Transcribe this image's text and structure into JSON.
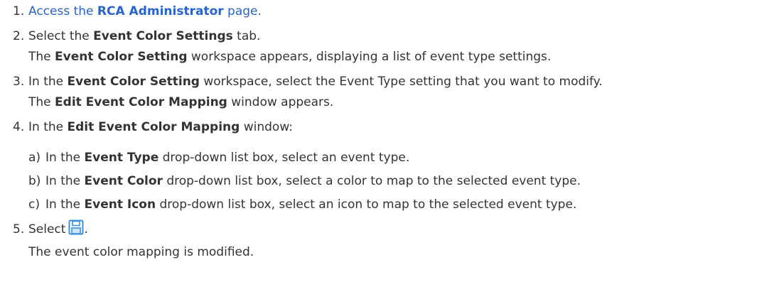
{
  "steps": [
    {
      "num": "1.",
      "pre": "Access the ",
      "bold": "RCA Administrator",
      "post": " page."
    },
    {
      "num": "2.",
      "pre": "Select the ",
      "bold": "Event Color Settings",
      "post": " tab.",
      "result_pre": "The ",
      "result_bold": "Event Color Setting",
      "result_post": " workspace appears, displaying a list of event type settings."
    },
    {
      "num": "3.",
      "pre": "In the ",
      "bold": "Event Color Setting",
      "post": " workspace, select the Event Type setting that you want to modify.",
      "result_pre": "The ",
      "result_bold": "Edit Event Color Mapping",
      "result_post": " window appears."
    },
    {
      "num": "4.",
      "pre": "In the ",
      "bold": "Edit Event Color Mapping",
      "post": " window:",
      "substeps": [
        {
          "letter": "a)",
          "pre": "In the ",
          "bold": "Event Type",
          "post": " drop-down list box, select an event type."
        },
        {
          "letter": "b)",
          "pre": "In the ",
          "bold": "Event Color",
          "post": " drop-down list box, select a color to map to the selected event type."
        },
        {
          "letter": "c)",
          "pre": "In the ",
          "bold": "Event Icon",
          "post": " drop-down list box, select an icon to map to the selected event type."
        }
      ]
    },
    {
      "num": "5.",
      "pre": "Select",
      "icon": "save-icon",
      "post": ".",
      "result": "The event color mapping is modified."
    }
  ],
  "colors": {
    "link": "#2a63c9",
    "text": "#333333",
    "icon": "#3a8fd9"
  }
}
